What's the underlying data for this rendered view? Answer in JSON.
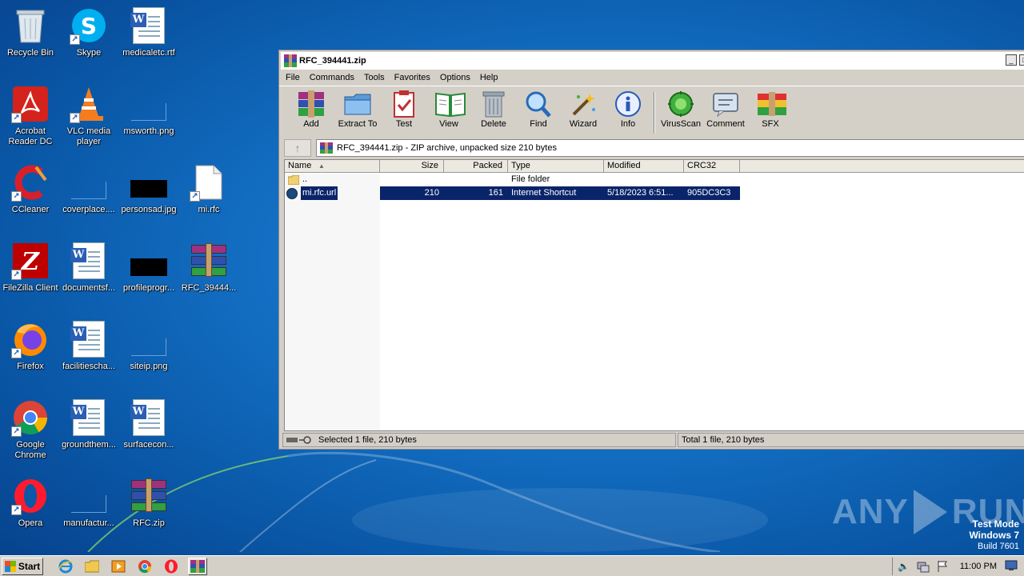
{
  "desktop": {
    "icons": [
      {
        "label": "Recycle Bin"
      },
      {
        "label": "Skype"
      },
      {
        "label": "medicaletc.rtf"
      },
      {
        "label": "Acrobat Reader DC"
      },
      {
        "label": "VLC media player"
      },
      {
        "label": "msworth.png"
      },
      {
        "label": "CCleaner"
      },
      {
        "label": "coverplace...."
      },
      {
        "label": "personsad.jpg"
      },
      {
        "label": "mi.rfc"
      },
      {
        "label": "FileZilla Client"
      },
      {
        "label": "documentsf..."
      },
      {
        "label": "profileprogr..."
      },
      {
        "label": "RFC_39444..."
      },
      {
        "label": "Firefox"
      },
      {
        "label": "facilitiescha..."
      },
      {
        "label": "siteip.png"
      },
      {
        "label": "Google Chrome"
      },
      {
        "label": "groundthem..."
      },
      {
        "label": "surfacecon..."
      },
      {
        "label": "Opera"
      },
      {
        "label": "manufactur..."
      },
      {
        "label": "RFC.zip"
      }
    ]
  },
  "window": {
    "title": "RFC_394441.zip",
    "menu": [
      "File",
      "Commands",
      "Tools",
      "Favorites",
      "Options",
      "Help"
    ],
    "toolbar": [
      "Add",
      "Extract To",
      "Test",
      "View",
      "Delete",
      "Find",
      "Wizard",
      "Info",
      "VirusScan",
      "Comment",
      "SFX"
    ],
    "address": "RFC_394441.zip - ZIP archive, unpacked size 210 bytes",
    "columns": [
      "Name",
      "Size",
      "Packed",
      "Type",
      "Modified",
      "CRC32"
    ],
    "rows": [
      {
        "name": "..",
        "size": "",
        "packed": "",
        "type": "File folder",
        "modified": "",
        "crc": ""
      },
      {
        "name": "mi.rfc.url",
        "size": "210",
        "packed": "161",
        "type": "Internet Shortcut",
        "modified": "5/18/2023 6:51...",
        "crc": "905DC3C3"
      }
    ],
    "status_left": "Selected 1 file, 210 bytes",
    "status_right": "Total 1 file, 210 bytes"
  },
  "watermark": {
    "brand_left": "ANY",
    "brand_right": "RUN",
    "line1": "Test Mode",
    "line2": "Windows 7",
    "line3": "Build 7601"
  },
  "taskbar": {
    "start": "Start",
    "clock": "11:00 PM"
  }
}
